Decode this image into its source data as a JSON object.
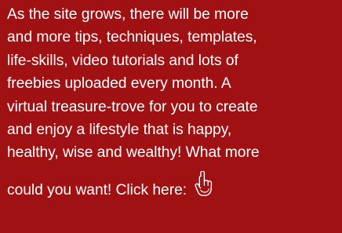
{
  "promo": {
    "lines": [
      "As the site grows, there will be more",
      "and more tips, techniques, templates,",
      "life-skills, video tutorials and lots of",
      "freebies uploaded every month. A",
      "virtual treasure-trove for you to create",
      "and enjoy a lifestyle that is happy,",
      "healthy, wise and wealthy! What more"
    ],
    "final_text": "could you want!",
    "link_text": "Click here:",
    "icon": "pointing-hand-icon"
  },
  "colors": {
    "background": "#9f1113",
    "text": "#ffffff"
  }
}
